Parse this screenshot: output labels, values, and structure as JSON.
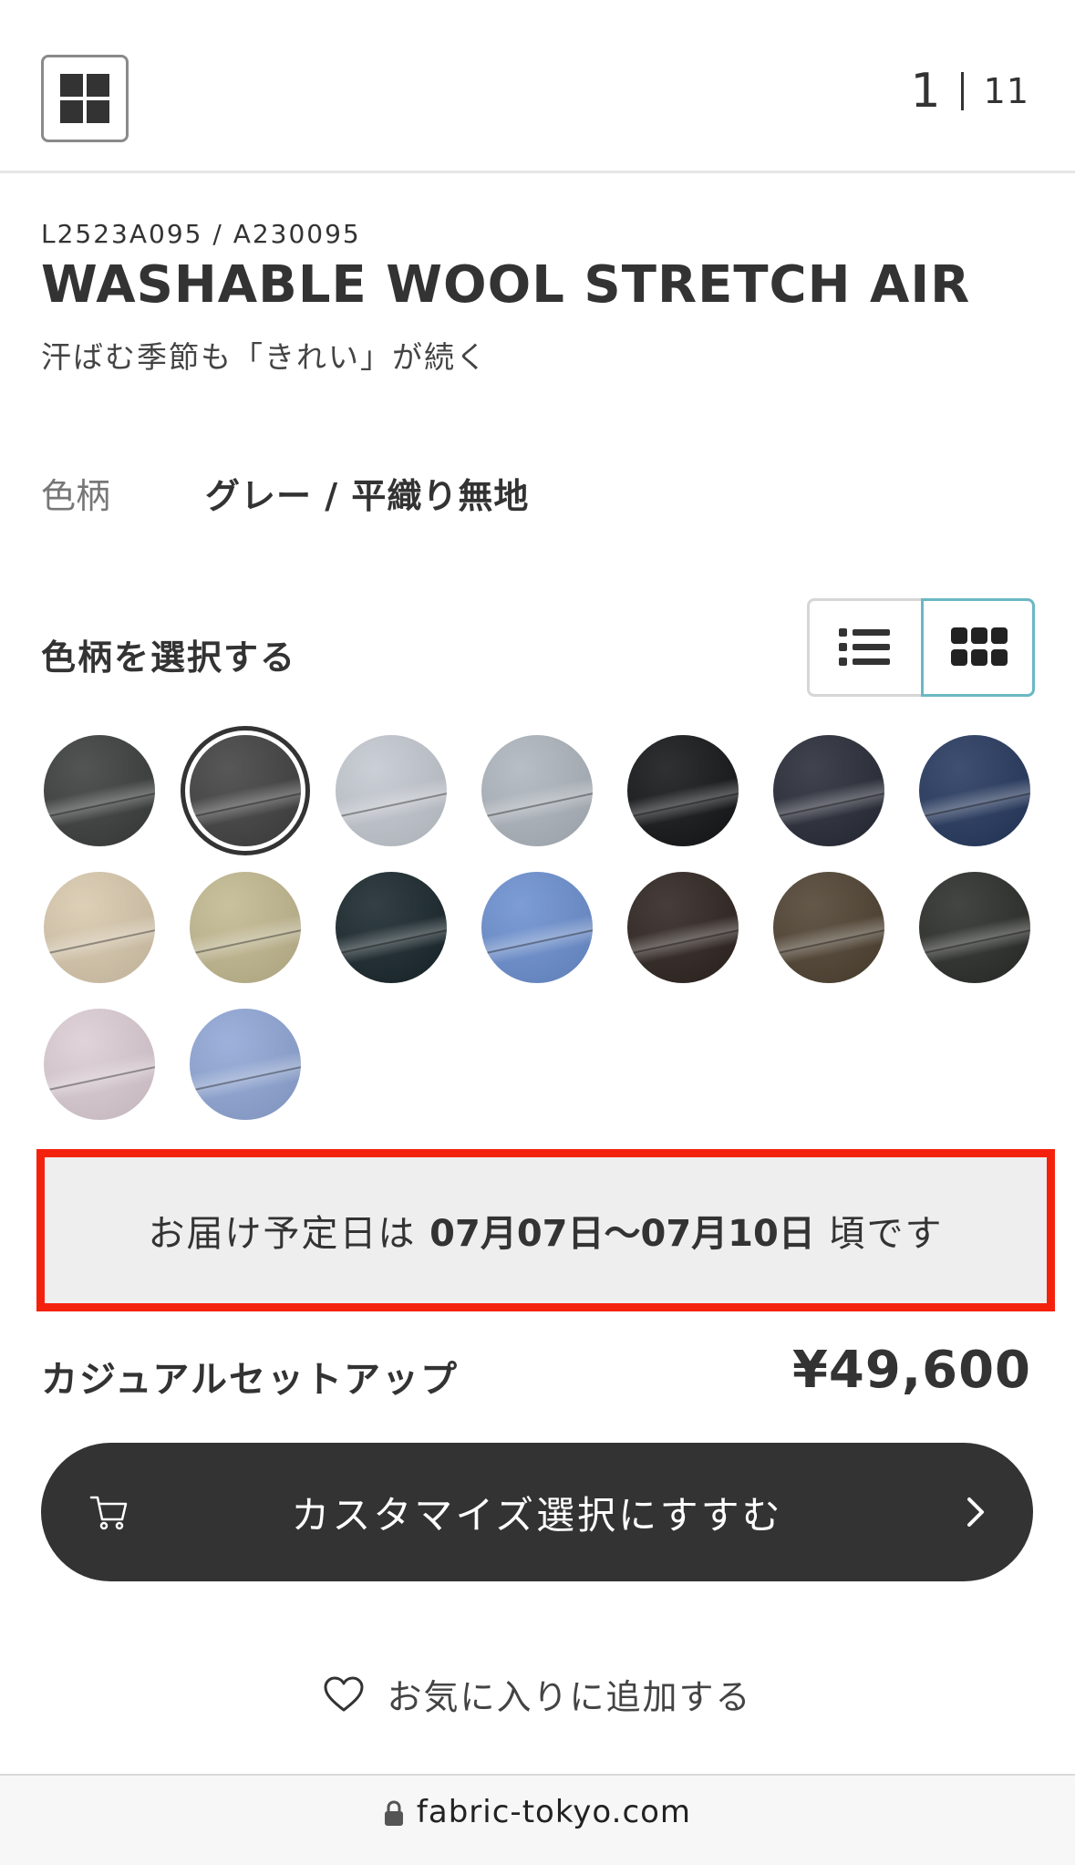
{
  "header": {
    "current_page": "1",
    "total_pages": "11"
  },
  "product": {
    "sku": "L2523A095 / A230095",
    "title": "WASHABLE WOOL STRETCH AIR",
    "subtitle": "汗ばむ季節も「きれい」が続く",
    "color_label": "色柄",
    "color_value": "グレー / 平織り無地"
  },
  "color_select": {
    "label": "色柄を選択する",
    "swatches": [
      {
        "color": "#3a3d3c",
        "selected": false
      },
      {
        "color": "#404040",
        "selected": true
      },
      {
        "color": "#c3c8d0",
        "selected": false
      },
      {
        "color": "#aeb5bd",
        "selected": false
      },
      {
        "color": "#131416",
        "selected": false
      },
      {
        "color": "#262a36",
        "selected": false
      },
      {
        "color": "#24375d",
        "selected": false
      },
      {
        "color": "#d9c9ad",
        "selected": false
      },
      {
        "color": "#c2b88f",
        "selected": false
      },
      {
        "color": "#17252a",
        "selected": false
      },
      {
        "color": "#6b8fd0",
        "selected": false
      },
      {
        "color": "#2d231f",
        "selected": false
      },
      {
        "color": "#4e4130",
        "selected": false
      },
      {
        "color": "#2a2c29",
        "selected": false
      },
      {
        "color": "#dccdd4",
        "selected": false
      },
      {
        "color": "#8fa6d6",
        "selected": false
      }
    ]
  },
  "delivery": {
    "prefix": "お届け予定日は",
    "dates": "07月07日〜07月10日",
    "suffix": "頃です"
  },
  "pricing": {
    "product_type": "カジュアルセットアップ",
    "price": "¥49,600"
  },
  "actions": {
    "customize_label": "カスタマイズ選択にすすむ",
    "favorite_label": "お気に入りに追加する"
  },
  "browser": {
    "url": "fabric-tokyo.com"
  },
  "colors": {
    "accent_dark": "#333333",
    "highlight_border": "#f4220d",
    "toggle_active_border": "#6bb8c4"
  }
}
